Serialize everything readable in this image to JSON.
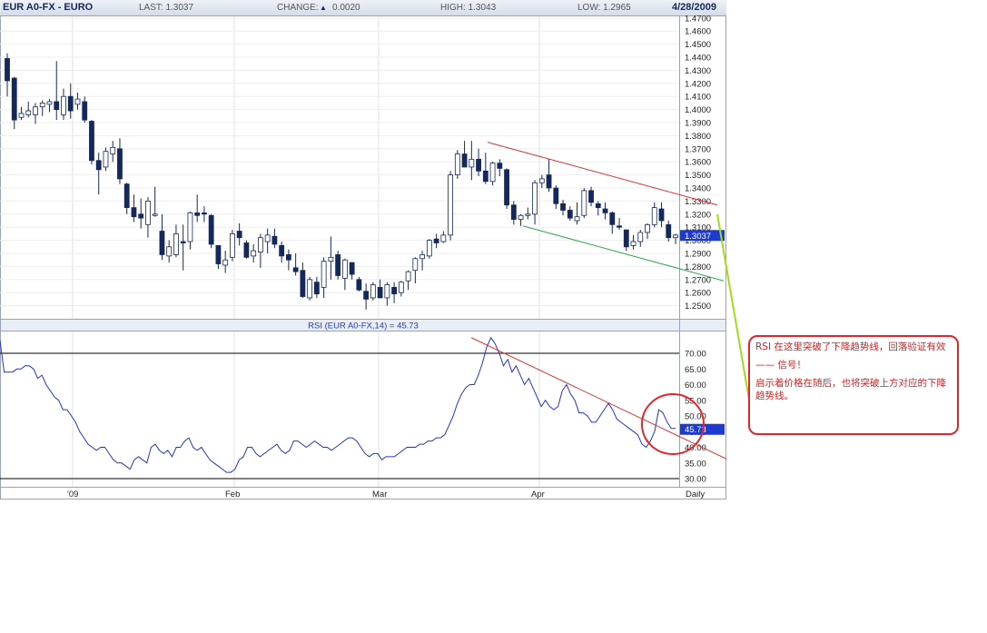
{
  "header": {
    "symbol": "EUR A0-FX - EURO",
    "last": "LAST: 1.3037",
    "change_label": "CHANGE:",
    "change_arrow": "▲",
    "change_value": "0.0020",
    "high": "HIGH: 1.3043",
    "low": "LOW: 1.2965",
    "date": "4/28/2009"
  },
  "colors": {
    "up_candle": "#ffffff",
    "down_candle": "#14285a",
    "rsi_line": "#2233cc",
    "resistance_line": "#e03030",
    "support_line": "#2ea84a",
    "annotation": "#e0262b",
    "pointer_line": "#9fdc1a"
  },
  "chart_data": [
    {
      "type": "candlestick",
      "title": "",
      "ylim": [
        1.24,
        1.47
      ],
      "y_ticks": [
        "1.4700",
        "1.4600",
        "1.4500",
        "1.4400",
        "1.4300",
        "1.4200",
        "1.4100",
        "1.4000",
        "1.3900",
        "1.3800",
        "1.3700",
        "1.3600",
        "1.3500",
        "1.3400",
        "1.3300",
        "1.3200",
        "1.3100",
        "1.3000",
        "1.2900",
        "1.2800",
        "1.2700",
        "1.2600",
        "1.2500"
      ],
      "last_price_label": "1.3037",
      "x_labels": [
        "'09",
        "Feb",
        "Mar",
        "Apr",
        "Daily"
      ],
      "candles": [
        [
          1.439,
          1.443,
          1.41,
          1.422
        ],
        [
          1.424,
          1.425,
          1.385,
          1.392
        ],
        [
          1.394,
          1.402,
          1.392,
          1.397
        ],
        [
          1.396,
          1.406,
          1.394,
          1.399
        ],
        [
          1.396,
          1.405,
          1.389,
          1.402
        ],
        [
          1.402,
          1.407,
          1.395,
          1.405
        ],
        [
          1.404,
          1.408,
          1.398,
          1.406
        ],
        [
          1.406,
          1.437,
          1.392,
          1.4
        ],
        [
          1.396,
          1.416,
          1.392,
          1.41
        ],
        [
          1.41,
          1.42,
          1.393,
          1.399
        ],
        [
          1.404,
          1.413,
          1.4,
          1.408
        ],
        [
          1.406,
          1.41,
          1.39,
          1.392
        ],
        [
          1.391,
          1.392,
          1.358,
          1.361
        ],
        [
          1.361,
          1.367,
          1.335,
          1.354
        ],
        [
          1.356,
          1.371,
          1.353,
          1.368
        ],
        [
          1.366,
          1.376,
          1.36,
          1.371
        ],
        [
          1.37,
          1.378,
          1.343,
          1.347
        ],
        [
          1.343,
          1.344,
          1.32,
          1.325
        ],
        [
          1.325,
          1.335,
          1.314,
          1.318
        ],
        [
          1.32,
          1.332,
          1.309,
          1.317
        ],
        [
          1.312,
          1.333,
          1.302,
          1.33
        ],
        [
          1.319,
          1.341,
          1.318,
          1.32
        ],
        [
          1.307,
          1.32,
          1.285,
          1.289
        ],
        [
          1.288,
          1.3,
          1.283,
          1.295
        ],
        [
          1.289,
          1.312,
          1.287,
          1.305
        ],
        [
          1.299,
          1.312,
          1.277,
          1.298
        ],
        [
          1.299,
          1.322,
          1.293,
          1.321
        ],
        [
          1.321,
          1.335,
          1.314,
          1.319
        ],
        [
          1.321,
          1.326,
          1.314,
          1.32
        ],
        [
          1.319,
          1.32,
          1.294,
          1.297
        ],
        [
          1.296,
          1.296,
          1.278,
          1.282
        ],
        [
          1.281,
          1.292,
          1.275,
          1.285
        ],
        [
          1.287,
          1.308,
          1.284,
          1.305
        ],
        [
          1.307,
          1.313,
          1.296,
          1.302
        ],
        [
          1.298,
          1.3,
          1.286,
          1.287
        ],
        [
          1.288,
          1.297,
          1.283,
          1.292
        ],
        [
          1.291,
          1.305,
          1.279,
          1.302
        ],
        [
          1.299,
          1.309,
          1.29,
          1.304
        ],
        [
          1.303,
          1.309,
          1.294,
          1.297
        ],
        [
          1.296,
          1.299,
          1.283,
          1.288
        ],
        [
          1.289,
          1.293,
          1.277,
          1.285
        ],
        [
          1.279,
          1.29,
          1.273,
          1.276
        ],
        [
          1.277,
          1.283,
          1.256,
          1.257
        ],
        [
          1.256,
          1.272,
          1.254,
          1.27
        ],
        [
          1.268,
          1.272,
          1.256,
          1.259
        ],
        [
          1.264,
          1.287,
          1.256,
          1.284
        ],
        [
          1.284,
          1.303,
          1.27,
          1.287
        ],
        [
          1.289,
          1.292,
          1.27,
          1.273
        ],
        [
          1.271,
          1.286,
          1.262,
          1.285
        ],
        [
          1.283,
          1.283,
          1.27,
          1.274
        ],
        [
          1.27,
          1.272,
          1.261,
          1.262
        ],
        [
          1.261,
          1.267,
          1.247,
          1.255
        ],
        [
          1.256,
          1.268,
          1.254,
          1.266
        ],
        [
          1.264,
          1.27,
          1.256,
          1.256
        ],
        [
          1.256,
          1.268,
          1.25,
          1.266
        ],
        [
          1.264,
          1.268,
          1.252,
          1.259
        ],
        [
          1.26,
          1.269,
          1.257,
          1.268
        ],
        [
          1.269,
          1.277,
          1.262,
          1.276
        ],
        [
          1.277,
          1.287,
          1.267,
          1.286
        ],
        [
          1.286,
          1.292,
          1.277,
          1.289
        ],
        [
          1.288,
          1.301,
          1.286,
          1.3
        ],
        [
          1.301,
          1.305,
          1.294,
          1.298
        ],
        [
          1.299,
          1.307,
          1.298,
          1.304
        ],
        [
          1.304,
          1.353,
          1.3,
          1.35
        ],
        [
          1.35,
          1.369,
          1.347,
          1.366
        ],
        [
          1.366,
          1.376,
          1.358,
          1.356
        ],
        [
          1.356,
          1.376,
          1.346,
          1.362
        ],
        [
          1.362,
          1.37,
          1.349,
          1.353
        ],
        [
          1.353,
          1.367,
          1.343,
          1.345
        ],
        [
          1.345,
          1.36,
          1.342,
          1.359
        ],
        [
          1.359,
          1.362,
          1.349,
          1.355
        ],
        [
          1.354,
          1.355,
          1.324,
          1.327
        ],
        [
          1.327,
          1.33,
          1.312,
          1.316
        ],
        [
          1.316,
          1.32,
          1.311,
          1.319
        ],
        [
          1.319,
          1.325,
          1.316,
          1.32
        ],
        [
          1.32,
          1.346,
          1.312,
          1.344
        ],
        [
          1.344,
          1.35,
          1.34,
          1.347
        ],
        [
          1.35,
          1.362,
          1.337,
          1.34
        ],
        [
          1.34,
          1.342,
          1.324,
          1.328
        ],
        [
          1.328,
          1.331,
          1.319,
          1.323
        ],
        [
          1.323,
          1.326,
          1.315,
          1.317
        ],
        [
          1.315,
          1.329,
          1.312,
          1.318
        ],
        [
          1.319,
          1.34,
          1.317,
          1.338
        ],
        [
          1.338,
          1.341,
          1.326,
          1.329
        ],
        [
          1.328,
          1.33,
          1.319,
          1.325
        ],
        [
          1.324,
          1.329,
          1.316,
          1.321
        ],
        [
          1.321,
          1.322,
          1.305,
          1.312
        ],
        [
          1.311,
          1.317,
          1.308,
          1.31
        ],
        [
          1.308,
          1.308,
          1.292,
          1.295
        ],
        [
          1.296,
          1.304,
          1.293,
          1.299
        ],
        [
          1.299,
          1.308,
          1.295,
          1.306
        ],
        [
          1.306,
          1.313,
          1.301,
          1.312
        ],
        [
          1.312,
          1.329,
          1.31,
          1.325
        ],
        [
          1.324,
          1.329,
          1.31,
          1.315
        ],
        [
          1.312,
          1.315,
          1.299,
          1.302
        ],
        [
          1.302,
          1.305,
          1.297,
          1.304
        ]
      ]
    },
    {
      "type": "line",
      "title": "RSI (EUR A0-FX,14) = 45.73",
      "ylim": [
        27,
        75
      ],
      "y_ticks": [
        "70.00",
        "65.00",
        "60.00",
        "55.00",
        "50.00",
        "45.00",
        "40.00",
        "35.00",
        "30.00"
      ],
      "reference_lines": [
        70,
        30
      ],
      "last_value_label": "45.73",
      "series": [
        {
          "values": [
            74,
            64,
            64,
            64,
            65,
            65,
            66,
            66,
            65,
            62,
            63,
            60,
            58,
            56,
            55,
            52,
            52,
            50,
            48,
            45,
            43,
            41,
            40,
            39,
            40,
            40,
            38,
            36,
            35,
            35,
            34,
            33,
            36,
            37,
            36,
            35,
            40,
            41,
            39,
            38,
            39,
            37,
            40,
            40,
            42,
            43,
            40,
            39,
            40,
            38,
            36,
            35,
            34,
            33,
            32,
            32,
            33,
            36,
            37,
            40,
            40,
            38,
            37,
            38,
            39,
            40,
            41,
            39,
            38,
            39,
            42,
            42,
            41,
            40,
            41,
            42,
            41,
            40,
            40,
            39,
            40,
            41,
            42,
            43,
            43,
            42,
            40,
            38,
            37,
            38,
            38,
            36,
            37,
            37,
            37,
            38,
            39,
            40,
            40,
            40,
            41,
            41,
            42,
            42,
            43,
            43,
            44,
            47,
            50,
            54,
            57,
            59,
            60,
            60,
            63,
            67,
            72,
            75,
            73,
            70,
            66,
            68,
            64,
            66,
            63,
            60,
            62,
            59,
            56,
            53,
            55,
            53,
            52,
            53,
            58,
            60,
            57,
            55,
            51,
            51,
            50,
            48,
            48,
            50,
            52,
            54,
            52,
            49,
            48,
            47,
            46,
            45,
            44,
            41,
            40,
            42,
            45,
            52,
            51,
            48,
            46,
            46
          ]
        }
      ]
    }
  ],
  "annotation": {
    "line1": "RSI 在这里突破了下降趋势线，回落验证有效",
    "line2": "—— 信号！",
    "line3": "启示着价格在随后，也将突破上方对应的下降趋势线。"
  }
}
